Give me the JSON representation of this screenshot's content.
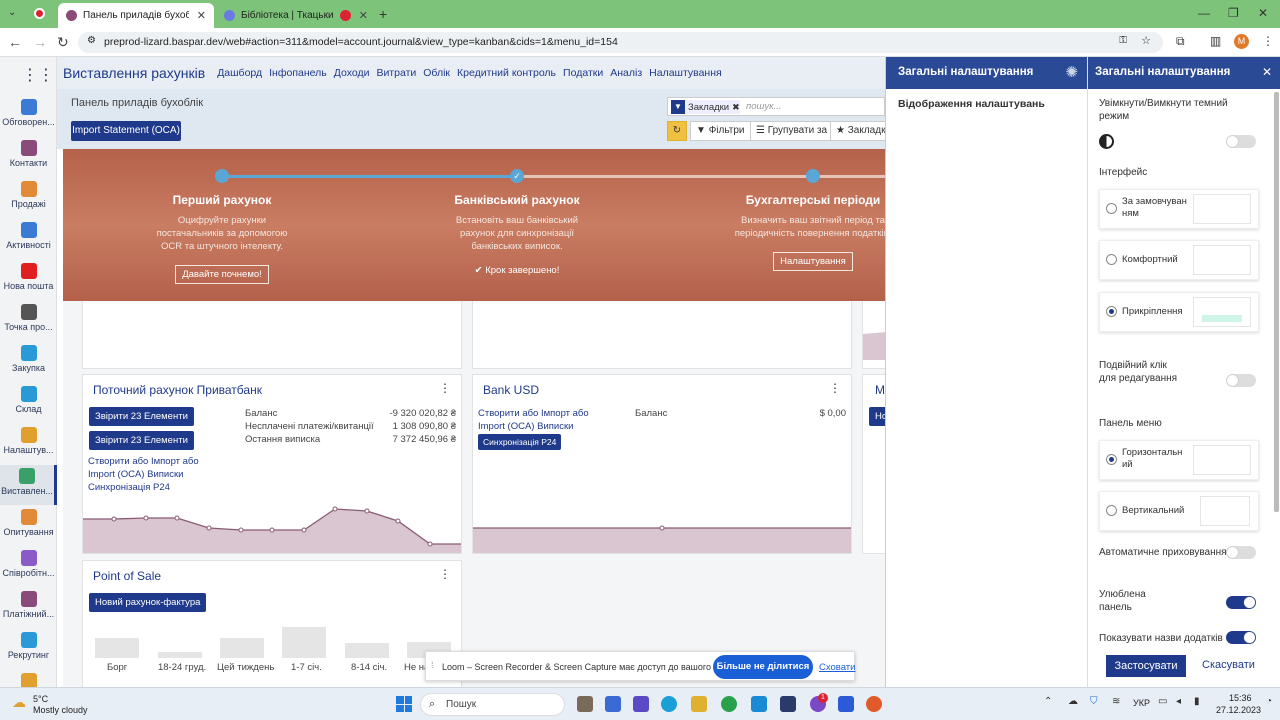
{
  "browser": {
    "tabs": [
      {
        "label": "Панель приладів бухоблік · I",
        "active": true
      },
      {
        "label": "Бібліотека | Ткацький вер"
      }
    ],
    "url": "preprod-lizard.baspar.dev/web#action=311&model=account.journal&view_type=kanban&cids=1&menu_id=154",
    "profile_initial": "M"
  },
  "sidebar": {
    "items": [
      {
        "label": "Обговорен...",
        "color": "#3b7bd6"
      },
      {
        "label": "Контакти",
        "color": "#8a4a7a"
      },
      {
        "label": "Продажі",
        "color": "#e08a3a"
      },
      {
        "label": "Активності",
        "color": "#3b7bd6"
      },
      {
        "label": "Нова пошта",
        "color": "#e02020"
      },
      {
        "label": "Точка про...",
        "color": "#555"
      },
      {
        "label": "Закупка",
        "color": "#2a9ad6"
      },
      {
        "label": "Склад",
        "color": "#2a9ad6"
      },
      {
        "label": "Налаштув...",
        "color": "#e0a030"
      },
      {
        "label": "Виставлен...",
        "color": "#3aa06a",
        "active": true
      },
      {
        "label": "Опитування",
        "color": "#e08a3a"
      },
      {
        "label": "Співробітн...",
        "color": "#8a5ac6"
      },
      {
        "label": "Платіжний...",
        "color": "#8a4a7a"
      },
      {
        "label": "Рекрутинг",
        "color": "#2a9ad6"
      },
      {
        "label": "",
        "color": "#e0a030"
      }
    ]
  },
  "topnav": {
    "app_title": "Виставлення рахунків",
    "items": [
      "Дашборд",
      "Інфопанель",
      "Доходи",
      "Витрати",
      "Облік",
      "Кредитний контроль",
      "Податки",
      "Аналіз",
      "Налаштування"
    ]
  },
  "control_panel": {
    "breadcrumb": "Панель приладів бухоблік",
    "import_button": "Import Statement (OCA)",
    "facet_label": "Закладки",
    "search_placeholder": "пошук...",
    "filters": "Фільтри",
    "group_by": "Групувати за",
    "favorites": "Закладк"
  },
  "banner": {
    "steps": [
      {
        "title": "Перший рахунок",
        "desc": "Оцифруйте рахунки постачальників за допомогою OCR та штучного інтелекту.",
        "button": "Давайте почнемо!"
      },
      {
        "title": "Банківський рахунок",
        "desc": "Встановіть ваш банківський рахунок для синхронізації банківських виписок.",
        "done": "✔ Крок завершено!"
      },
      {
        "title": "Бухгалтерські періоди",
        "desc": "Визначить ваш звітний період та періодичність повернення податків.",
        "button": "Налаштування"
      }
    ]
  },
  "cards": {
    "privat": {
      "title": "Поточний рахунок Приватбанк",
      "btn1": "Звірити 23 Елементи",
      "btn2": "Звірити 23 Елементи",
      "link1": "Створити або Імпорт або",
      "link2": "Import (OCA) Виписки",
      "link3": "Синхронізація Р24",
      "balance_label": "Баланс",
      "balance_val": "-9 320 020,82 ₴",
      "unpaid_label": "Несплачені платежі/квитанції",
      "unpaid_val": "1 308 090,80 ₴",
      "last_label": "Остання виписка",
      "last_val": "7 372 450,96 ₴"
    },
    "usd": {
      "title": "Bank USD",
      "link1": "Створити або Імпорт або",
      "link2": "Import (OCA) Виписки",
      "sync_btn": "Синхронізація Р24",
      "balance_label": "Баланс",
      "balance_val": "$ 0,00"
    },
    "third_title": "M",
    "third_btn": "Но",
    "pos": {
      "title": "Point of Sale",
      "btn": "Новий рахунок-фактура",
      "bars": [
        "Борг",
        "18-24 груд.",
        "Цей тиждень",
        "1-7 січ.",
        "8-14 січ.",
        "Не на"
      ]
    }
  },
  "settings_left": {
    "header": "Загальні налаштування",
    "item": "Відображення налаштувань"
  },
  "settings_right": {
    "header": "Загальні налаштування",
    "dark_mode": "Увімкнути/Вимкнути темний режим",
    "interface": "Інтерфейс",
    "opt_default": "За замовчуван ням",
    "opt_comfort": "Комфортний",
    "opt_attach": "Прикріплення",
    "dblclick": "Подвійний клік для редагування",
    "menu_panel": "Панель меню",
    "opt_horizontal": "Горизонтальн ий",
    "opt_vertical": "Вертикальний",
    "autohide": "Автоматичне приховування",
    "favorite_panel": "Улюблена панель",
    "show_names": "Показувати назви додатків",
    "apply": "Застосувати",
    "cancel": "Скасувати"
  },
  "loom": {
    "text": "Loom – Screen Recorder & Screen Capture має доступ до вашого екрана.",
    "stop": "Більше не ділитися",
    "hide": "Сховати"
  },
  "taskbar": {
    "temp": "5°C",
    "weather": "Mostly cloudy",
    "search": "Пошук",
    "lang": "УКР",
    "time": "15:36",
    "date": "27.12.2023",
    "badge": "1"
  }
}
